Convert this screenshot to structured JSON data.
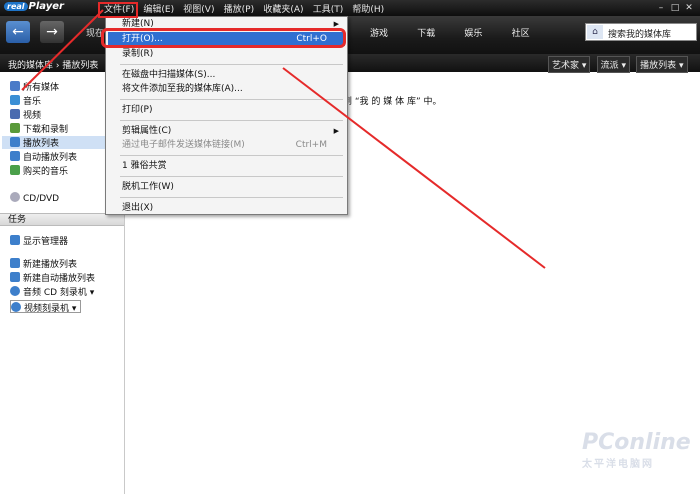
{
  "app": {
    "logo_text": "real",
    "logo_sub": "Player"
  },
  "menubar": [
    "文件(F)",
    "编辑(E)",
    "视图(V)",
    "播放(P)",
    "收藏夹(A)",
    "工具(T)",
    "帮助(H)"
  ],
  "nav": {
    "back_icon": "←",
    "forward_icon": "→",
    "current": "现在",
    "tabs": [
      "游戏",
      "下载",
      "娱乐",
      "社区"
    ],
    "search_text": "搜索我的媒体库",
    "home_icon": "⌂"
  },
  "breadcrumb": {
    "path": "我的媒体库 › 播放列表",
    "dropdowns": [
      "艺术家 ▾",
      "流派 ▾",
      "播放列表 ▾"
    ]
  },
  "sidebar": {
    "items": [
      {
        "label": "所有媒体",
        "color": "#4a7bc8"
      },
      {
        "label": "音乐",
        "color": "#3b8fd5"
      },
      {
        "label": "视频",
        "color": "#4a6cb0"
      },
      {
        "label": "下载和录制",
        "color": "#5a9a3a"
      },
      {
        "label": "播放列表",
        "color": "#3d7fcb"
      },
      {
        "label": "自动播放列表",
        "color": "#3d7fcb"
      },
      {
        "label": "购买的音乐",
        "color": "#4aa04a"
      }
    ],
    "cd_label": "CD/DVD",
    "tasks_header": "任务",
    "tasks": [
      {
        "label": "显示管理器",
        "color": "#3d7fcb"
      },
      {
        "label": "新建播放列表",
        "color": "#3d7fcb"
      },
      {
        "label": "新建自动播放列表",
        "color": "#3d7fcb"
      },
      {
        "label": "音频 CD 刻录机 ▾",
        "color": "#3d7fcb"
      },
      {
        "label": "视频刻录机 ▾",
        "color": "#3d7fcb"
      }
    ]
  },
  "main": {
    "message": "到 “我 的 媒 体 库” 中。"
  },
  "file_menu": {
    "items": [
      {
        "label": "新建(N)",
        "shortcut": "",
        "arrow": "▶",
        "state": "normal"
      },
      {
        "label": "打开(O)...",
        "shortcut": "Ctrl+O",
        "arrow": "",
        "state": "highlight"
      },
      {
        "label": "录制(R)",
        "shortcut": "",
        "arrow": "",
        "state": "normal"
      },
      {
        "label": "在磁盘中扫描媒体(S)...",
        "shortcut": "",
        "arrow": "",
        "state": "normal"
      },
      {
        "label": "将文件添加至我的媒体库(A)...",
        "shortcut": "",
        "arrow": "",
        "state": "normal"
      },
      {
        "label": "打印(P)",
        "shortcut": "",
        "arrow": "",
        "state": "normal"
      },
      {
        "label": "剪辑属性(C)",
        "shortcut": "",
        "arrow": "▶",
        "state": "normal"
      },
      {
        "label": "通过电子邮件发送媒体链接(M)",
        "shortcut": "Ctrl+M",
        "arrow": "",
        "state": "disabled"
      },
      {
        "label": "1 雅俗共赏",
        "shortcut": "",
        "arrow": "",
        "state": "normal"
      },
      {
        "label": "脱机工作(W)",
        "shortcut": "",
        "arrow": "",
        "state": "normal"
      },
      {
        "label": "退出(X)",
        "shortcut": "",
        "arrow": "",
        "state": "normal"
      }
    ]
  },
  "watermark": {
    "logo": "PConline",
    "sub": "太平洋电脑网"
  }
}
